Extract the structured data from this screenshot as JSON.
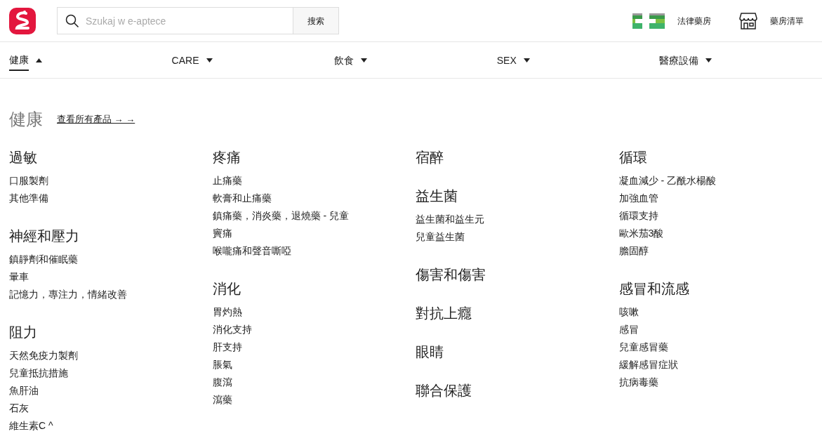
{
  "search": {
    "placeholder": "Szukaj w e-aptece",
    "button": "搜索"
  },
  "header_links": [
    {
      "kind": "legal",
      "label": "法律藥房"
    },
    {
      "kind": "store",
      "label": "藥房清單"
    }
  ],
  "nav": [
    {
      "label": "健康",
      "selected": true
    },
    {
      "label": "CARE",
      "selected": false
    },
    {
      "label": "飲食",
      "selected": false
    },
    {
      "label": "SEX",
      "selected": false
    },
    {
      "label": "醫療設備",
      "selected": false
    }
  ],
  "section": {
    "title": "健康",
    "all_link": "查看所有產品 → →"
  },
  "columns": [
    [
      {
        "title": "過敏",
        "items": [
          "口服製劑",
          "其他準備"
        ]
      },
      {
        "title": "神經和壓力",
        "items": [
          "鎮靜劑和催眠藥",
          "暈車",
          "記憶力，專注力，情緒改善"
        ]
      },
      {
        "title": "阻力",
        "items": [
          "天然免疫力製劑",
          "兒童抵抗措施",
          "魚肝油",
          "石灰",
          "維生素C ^"
        ]
      }
    ],
    [
      {
        "title": "疼痛",
        "items": [
          "止痛藥",
          "軟膏和止痛藥",
          "鎮痛藥，消炎藥，退燒藥 - 兒童",
          "竇痛",
          "喉嚨痛和聲音嘶啞"
        ]
      },
      {
        "title": "消化",
        "items": [
          "胃灼熱",
          "消化支持",
          "肝支持",
          "脹氣",
          "腹瀉",
          "瀉藥"
        ]
      }
    ],
    [
      {
        "title": "宿醉"
      },
      {
        "title": "益生菌",
        "items": [
          "益生菌和益生元",
          "兒童益生菌"
        ]
      },
      {
        "title": "傷害和傷害"
      },
      {
        "title": "對抗上癮"
      },
      {
        "title": "眼睛"
      },
      {
        "title": "聯合保護"
      }
    ],
    [
      {
        "title": "循環",
        "items": [
          "凝血減少 - 乙酰水楊酸",
          "加強血管",
          "循環支持",
          "歐米茄3酸",
          "膽固醇"
        ]
      },
      {
        "title": "感冒和流感",
        "items": [
          "咳嗽",
          "感冒",
          "兒童感冒藥",
          "緩解感冒症狀",
          "抗病毒藥"
        ]
      }
    ]
  ]
}
